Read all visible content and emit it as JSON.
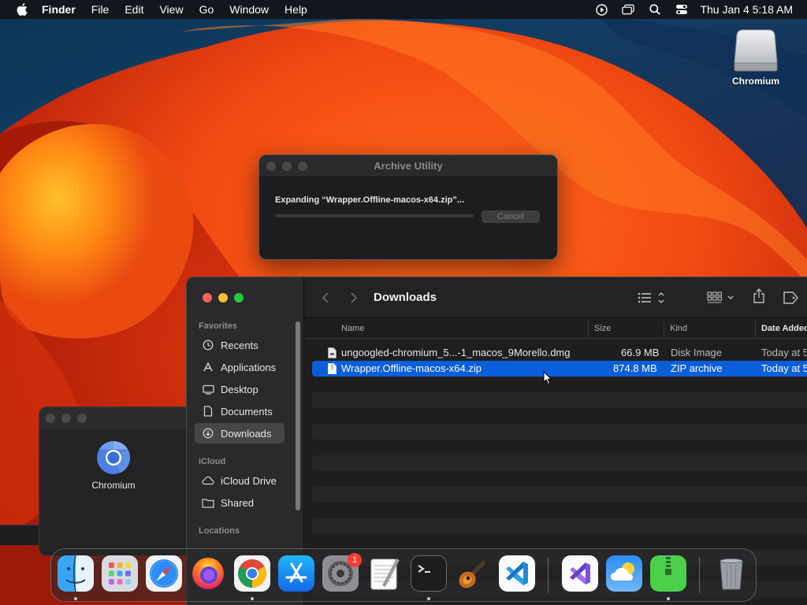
{
  "menubar": {
    "app_name": "Finder",
    "menus": [
      "File",
      "Edit",
      "View",
      "Go",
      "Window",
      "Help"
    ],
    "clock": "Thu Jan 4  5:18 AM",
    "status_icons": [
      "play-circle-icon",
      "screen-mirroring-icon",
      "search-icon",
      "control-center-icon"
    ]
  },
  "desktop": {
    "drive_label": "Chromium"
  },
  "archive_utility": {
    "title": "Archive Utility",
    "message": "Expanding “Wrapper.Offline-macos-x64.zip”...",
    "progress": 0,
    "cancel_label": "Cancel"
  },
  "back_window": {
    "item_label": "Chromium"
  },
  "finder": {
    "title": "Downloads",
    "sidebar": {
      "favorites_label": "Favorites",
      "favorites": [
        {
          "label": "Recents",
          "icon": "clock-icon"
        },
        {
          "label": "Applications",
          "icon": "applications-icon"
        },
        {
          "label": "Desktop",
          "icon": "desktop-icon"
        },
        {
          "label": "Documents",
          "icon": "document-icon"
        },
        {
          "label": "Downloads",
          "icon": "download-icon"
        }
      ],
      "icloud_label": "iCloud",
      "icloud": [
        {
          "label": "iCloud Drive",
          "icon": "cloud-icon"
        },
        {
          "label": "Shared",
          "icon": "shared-folder-icon"
        }
      ],
      "locations_label": "Locations"
    },
    "columns": {
      "name": "Name",
      "size": "Size",
      "kind": "Kind",
      "date": "Date Added"
    },
    "files": [
      {
        "name": "ungoogled-chromium_5...-1_macos_9Morello.dmg",
        "size": "66.9 MB",
        "kind": "Disk Image",
        "date": "Today at 5"
      },
      {
        "name": "Wrapper.Offline-macos-x64.zip",
        "size": "874.8 MB",
        "kind": "ZIP archive",
        "date": "Today at 5"
      }
    ]
  },
  "dock": {
    "apps": [
      "Finder",
      "Launchpad",
      "Safari",
      "Firefox",
      "Chrome",
      "App Store",
      "System Settings",
      "TextEdit",
      "Terminal",
      "Instruments",
      "Visual Studio Code",
      "Visual Studio",
      "Weather",
      "Archive Utility",
      "Trash"
    ],
    "system_settings_badge": "1",
    "colors": {
      "selection": "#0a5fd8",
      "close": "#ff5f57",
      "minimize": "#febc2e",
      "zoom": "#28c840"
    }
  }
}
